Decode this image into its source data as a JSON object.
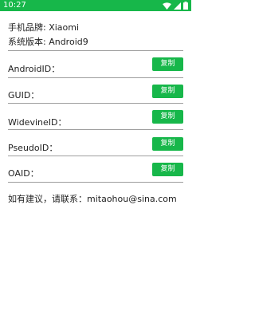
{
  "status_bar": {
    "time": "10:27",
    "icons": [
      "wifi-icon",
      "signal-icon",
      "battery-icon"
    ],
    "color": "#17b74a"
  },
  "device": {
    "brand_line": "手机品牌: Xiaomi",
    "version_line": "系统版本: Android9"
  },
  "id_rows": [
    {
      "label": "AndroidID：",
      "button_label": "复制"
    },
    {
      "label": "GUID：",
      "button_label": "复制"
    },
    {
      "label": "WidevineID：",
      "button_label": "复制"
    },
    {
      "label": "PseudoID：",
      "button_label": "复制"
    },
    {
      "label": "OAID：",
      "button_label": "复制"
    }
  ],
  "contact": {
    "text": "如有建议，请联系：mitaohou@sina.com"
  },
  "colors": {
    "accent": "#17b74a",
    "divider": "#9e9e9e",
    "text": "#222222"
  }
}
